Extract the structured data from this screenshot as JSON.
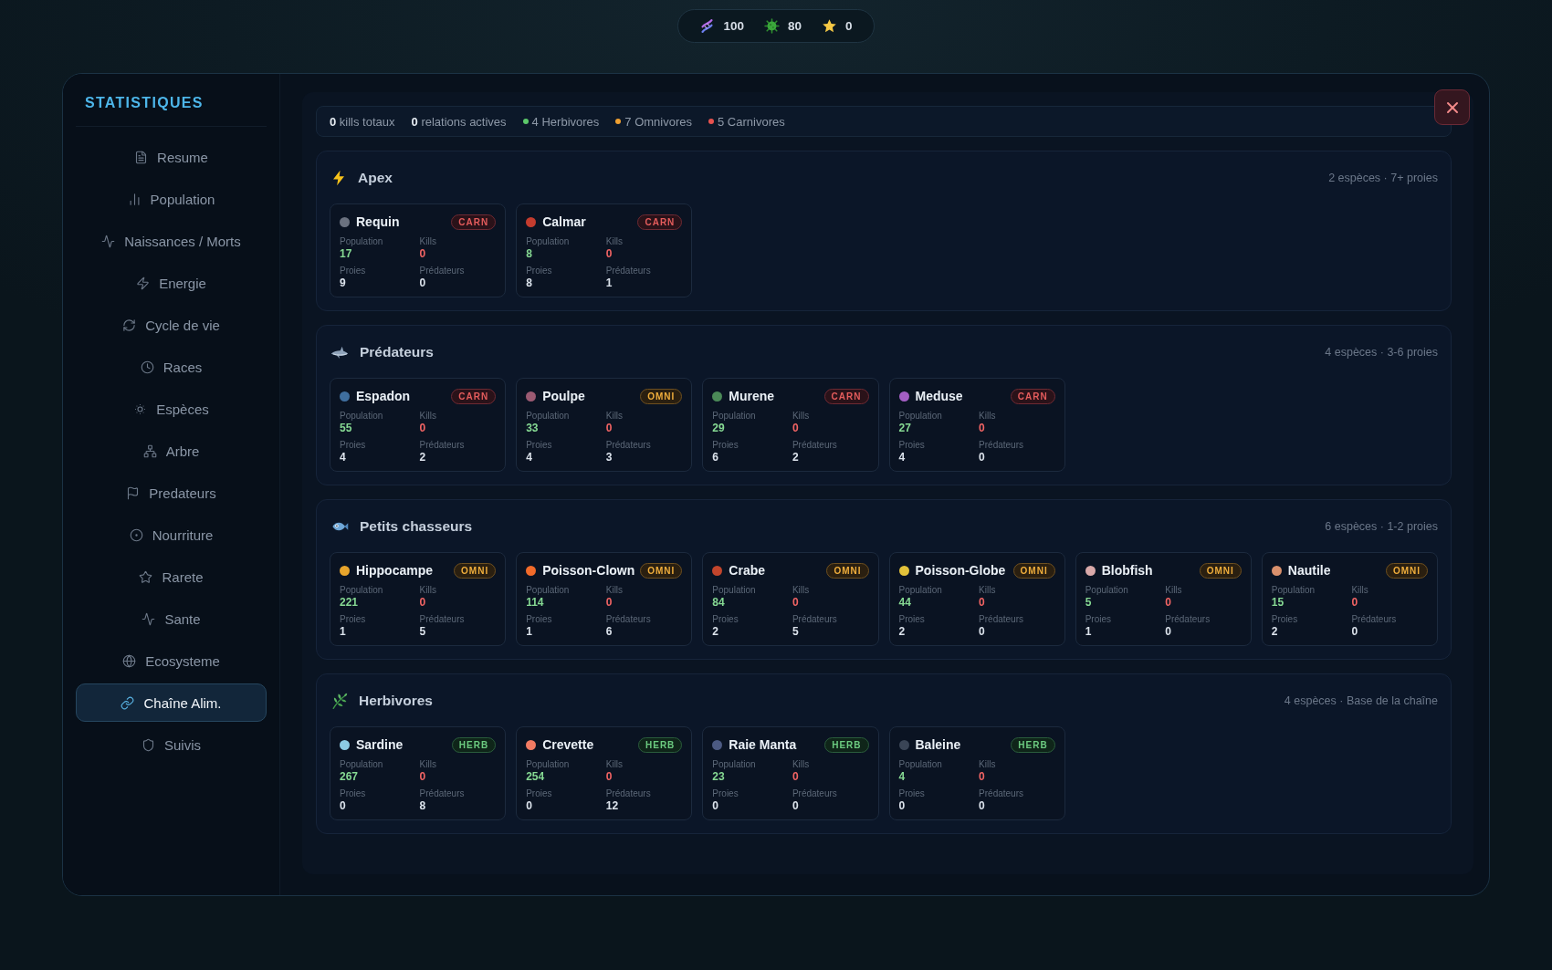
{
  "resources": [
    {
      "value": "100"
    },
    {
      "value": "80"
    },
    {
      "value": "0"
    }
  ],
  "sidebar": {
    "title": "STATISTIQUES",
    "items": [
      {
        "label": "Resume",
        "selected": false
      },
      {
        "label": "Population",
        "selected": false
      },
      {
        "label": "Naissances / Morts",
        "selected": false
      },
      {
        "label": "Energie",
        "selected": false
      },
      {
        "label": "Cycle de vie",
        "selected": false
      },
      {
        "label": "Races",
        "selected": false
      },
      {
        "label": "Espèces",
        "selected": false
      },
      {
        "label": "Arbre",
        "selected": false
      },
      {
        "label": "Predateurs",
        "selected": false
      },
      {
        "label": "Nourriture",
        "selected": false
      },
      {
        "label": "Rarete",
        "selected": false
      },
      {
        "label": "Sante",
        "selected": false
      },
      {
        "label": "Ecosysteme",
        "selected": false
      },
      {
        "label": "Chaîne Alim.",
        "selected": true
      },
      {
        "label": "Suivis",
        "selected": false
      }
    ]
  },
  "summary": [
    {
      "kind": "count",
      "text": "**0** kills totaux"
    },
    {
      "kind": "count",
      "text": "**0** relations actives"
    },
    {
      "kind": "legend",
      "text": "4 Herbivores",
      "color": "#5cc86a"
    },
    {
      "kind": "legend",
      "text": "7 Omnivores",
      "color": "#f0a030"
    },
    {
      "kind": "legend",
      "text": "5 Carnivores",
      "color": "#e8524f"
    }
  ],
  "sections": [
    {
      "title": "Apex",
      "summary": "2 espèces · 7+ proies",
      "species": [
        {
          "name": "Requin",
          "color": "#6b7280",
          "kind": "carn",
          "badge": "CARN",
          "stats": [
            {
              "kind": "population",
              "label": "Population",
              "value": "17"
            },
            {
              "kind": "kills",
              "label": "Kills",
              "value": "0"
            },
            {
              "kind": "count",
              "label": "Proies",
              "value": "9"
            },
            {
              "kind": "count",
              "label": "Prédateurs",
              "value": "0"
            }
          ]
        },
        {
          "name": "Calmar",
          "color": "#c43c2e",
          "kind": "carn",
          "badge": "CARN",
          "stats": [
            {
              "kind": "population",
              "label": "Population",
              "value": "8"
            },
            {
              "kind": "kills",
              "label": "Kills",
              "value": "0"
            },
            {
              "kind": "count",
              "label": "Proies",
              "value": "8"
            },
            {
              "kind": "count",
              "label": "Prédateurs",
              "value": "1"
            }
          ]
        }
      ]
    },
    {
      "title": "Prédateurs",
      "summary": "4 espèces · 3-6 proies",
      "species": [
        {
          "name": "Espadon",
          "color": "#3f6e9e",
          "kind": "carn",
          "badge": "CARN",
          "stats": [
            {
              "kind": "population",
              "label": "Population",
              "value": "55"
            },
            {
              "kind": "kills",
              "label": "Kills",
              "value": "0"
            },
            {
              "kind": "count",
              "label": "Proies",
              "value": "4"
            },
            {
              "kind": "count",
              "label": "Prédateurs",
              "value": "2"
            }
          ]
        },
        {
          "name": "Poulpe",
          "color": "#9b5a72",
          "kind": "omni",
          "badge": "OMNI",
          "stats": [
            {
              "kind": "population",
              "label": "Population",
              "value": "33"
            },
            {
              "kind": "kills",
              "label": "Kills",
              "value": "0"
            },
            {
              "kind": "count",
              "label": "Proies",
              "value": "4"
            },
            {
              "kind": "count",
              "label": "Prédateurs",
              "value": "3"
            }
          ]
        },
        {
          "name": "Murene",
          "color": "#4b8a58",
          "kind": "carn",
          "badge": "CARN",
          "stats": [
            {
              "kind": "population",
              "label": "Population",
              "value": "29"
            },
            {
              "kind": "kills",
              "label": "Kills",
              "value": "0"
            },
            {
              "kind": "count",
              "label": "Proies",
              "value": "6"
            },
            {
              "kind": "count",
              "label": "Prédateurs",
              "value": "2"
            }
          ]
        },
        {
          "name": "Meduse",
          "color": "#a45fc4",
          "kind": "carn",
          "badge": "CARN",
          "stats": [
            {
              "kind": "population",
              "label": "Population",
              "value": "27"
            },
            {
              "kind": "kills",
              "label": "Kills",
              "value": "0"
            },
            {
              "kind": "count",
              "label": "Proies",
              "value": "4"
            },
            {
              "kind": "count",
              "label": "Prédateurs",
              "value": "0"
            }
          ]
        }
      ]
    },
    {
      "title": "Petits chasseurs",
      "summary": "6 espèces · 1-2 proies",
      "species": [
        {
          "name": "Hippocampe",
          "color": "#e8a52c",
          "kind": "omni",
          "badge": "OMNI",
          "stats": [
            {
              "kind": "population",
              "label": "Population",
              "value": "221"
            },
            {
              "kind": "kills",
              "label": "Kills",
              "value": "0"
            },
            {
              "kind": "count",
              "label": "Proies",
              "value": "1"
            },
            {
              "kind": "count",
              "label": "Prédateurs",
              "value": "5"
            }
          ]
        },
        {
          "name": "Poisson-Clown",
          "color": "#f26b2a",
          "kind": "omni",
          "badge": "OMNI",
          "stats": [
            {
              "kind": "population",
              "label": "Population",
              "value": "114"
            },
            {
              "kind": "kills",
              "label": "Kills",
              "value": "0"
            },
            {
              "kind": "count",
              "label": "Proies",
              "value": "1"
            },
            {
              "kind": "count",
              "label": "Prédateurs",
              "value": "6"
            }
          ]
        },
        {
          "name": "Crabe",
          "color": "#c2452c",
          "kind": "omni",
          "badge": "OMNI",
          "stats": [
            {
              "kind": "population",
              "label": "Population",
              "value": "84"
            },
            {
              "kind": "kills",
              "label": "Kills",
              "value": "0"
            },
            {
              "kind": "count",
              "label": "Proies",
              "value": "2"
            },
            {
              "kind": "count",
              "label": "Prédateurs",
              "value": "5"
            }
          ]
        },
        {
          "name": "Poisson-Globe",
          "color": "#e3c23a",
          "kind": "omni",
          "badge": "OMNI",
          "stats": [
            {
              "kind": "population",
              "label": "Population",
              "value": "44"
            },
            {
              "kind": "kills",
              "label": "Kills",
              "value": "0"
            },
            {
              "kind": "count",
              "label": "Proies",
              "value": "2"
            },
            {
              "kind": "count",
              "label": "Prédateurs",
              "value": "0"
            }
          ]
        },
        {
          "name": "Blobfish",
          "color": "#d9a9a9",
          "kind": "omni",
          "badge": "OMNI",
          "stats": [
            {
              "kind": "population",
              "label": "Population",
              "value": "5"
            },
            {
              "kind": "kills",
              "label": "Kills",
              "value": "0"
            },
            {
              "kind": "count",
              "label": "Proies",
              "value": "1"
            },
            {
              "kind": "count",
              "label": "Prédateurs",
              "value": "0"
            }
          ]
        },
        {
          "name": "Nautile",
          "color": "#d9906c",
          "kind": "omni",
          "badge": "OMNI",
          "stats": [
            {
              "kind": "population",
              "label": "Population",
              "value": "15"
            },
            {
              "kind": "kills",
              "label": "Kills",
              "value": "0"
            },
            {
              "kind": "count",
              "label": "Proies",
              "value": "2"
            },
            {
              "kind": "count",
              "label": "Prédateurs",
              "value": "0"
            }
          ]
        }
      ]
    },
    {
      "title": "Herbivores",
      "summary": "4 espèces · Base de la chaîne",
      "species": [
        {
          "name": "Sardine",
          "color": "#8ccbe3",
          "kind": "herb",
          "badge": "HERB",
          "stats": [
            {
              "kind": "population",
              "label": "Population",
              "value": "267"
            },
            {
              "kind": "kills",
              "label": "Kills",
              "value": "0"
            },
            {
              "kind": "count",
              "label": "Proies",
              "value": "0"
            },
            {
              "kind": "count",
              "label": "Prédateurs",
              "value": "8"
            }
          ]
        },
        {
          "name": "Crevette",
          "color": "#f27b63",
          "kind": "herb",
          "badge": "HERB",
          "stats": [
            {
              "kind": "population",
              "label": "Population",
              "value": "254"
            },
            {
              "kind": "kills",
              "label": "Kills",
              "value": "0"
            },
            {
              "kind": "count",
              "label": "Proies",
              "value": "0"
            },
            {
              "kind": "count",
              "label": "Prédateurs",
              "value": "12"
            }
          ]
        },
        {
          "name": "Raie Manta",
          "color": "#4c5a82",
          "kind": "herb",
          "badge": "HERB",
          "stats": [
            {
              "kind": "population",
              "label": "Population",
              "value": "23"
            },
            {
              "kind": "kills",
              "label": "Kills",
              "value": "0"
            },
            {
              "kind": "count",
              "label": "Proies",
              "value": "0"
            },
            {
              "kind": "count",
              "label": "Prédateurs",
              "value": "0"
            }
          ]
        },
        {
          "name": "Baleine",
          "color": "#3a4556",
          "kind": "herb",
          "badge": "HERB",
          "stats": [
            {
              "kind": "population",
              "label": "Population",
              "value": "4"
            },
            {
              "kind": "kills",
              "label": "Kills",
              "value": "0"
            },
            {
              "kind": "count",
              "label": "Proies",
              "value": "0"
            },
            {
              "kind": "count",
              "label": "Prédateurs",
              "value": "0"
            }
          ]
        }
      ]
    }
  ]
}
